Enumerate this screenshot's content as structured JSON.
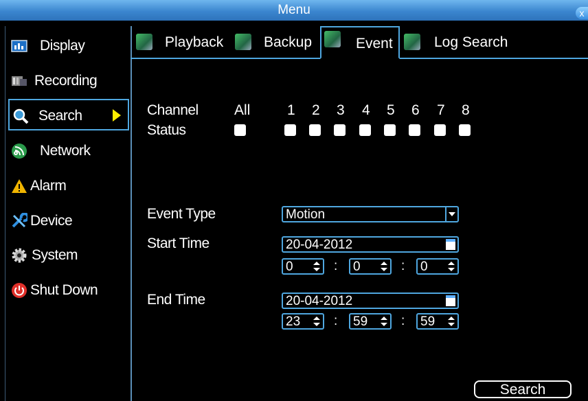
{
  "window": {
    "title": "Menu",
    "close_label": "x"
  },
  "sidebar": {
    "items": [
      {
        "label": "Display"
      },
      {
        "label": "Recording"
      },
      {
        "label": "Search"
      },
      {
        "label": "Network"
      },
      {
        "label": "Alarm"
      },
      {
        "label": "Device"
      },
      {
        "label": "System"
      },
      {
        "label": "Shut Down"
      }
    ],
    "active": "Search"
  },
  "tabs": [
    {
      "label": "Playback"
    },
    {
      "label": "Backup"
    },
    {
      "label": "Event"
    },
    {
      "label": "Log Search"
    }
  ],
  "channel": {
    "channel_label": "Channel",
    "status_label": "Status",
    "all_label": "All",
    "numbers": [
      "1",
      "2",
      "3",
      "4",
      "5",
      "6",
      "7",
      "8"
    ]
  },
  "event_type": {
    "label": "Event Type",
    "value": "Motion"
  },
  "start_time": {
    "label": "Start Time",
    "date": "20-04-2012",
    "hour": "0",
    "minute": "0",
    "second": "0"
  },
  "end_time": {
    "label": "End Time",
    "date": "20-04-2012",
    "hour": "23",
    "minute": "59",
    "second": "59"
  },
  "time_separator": ":",
  "search_button": "Search",
  "colors": {
    "accent": "#4fa7e0",
    "titlebar": "#3b86cf",
    "arrow": "#ffee00",
    "background": "#000000"
  }
}
